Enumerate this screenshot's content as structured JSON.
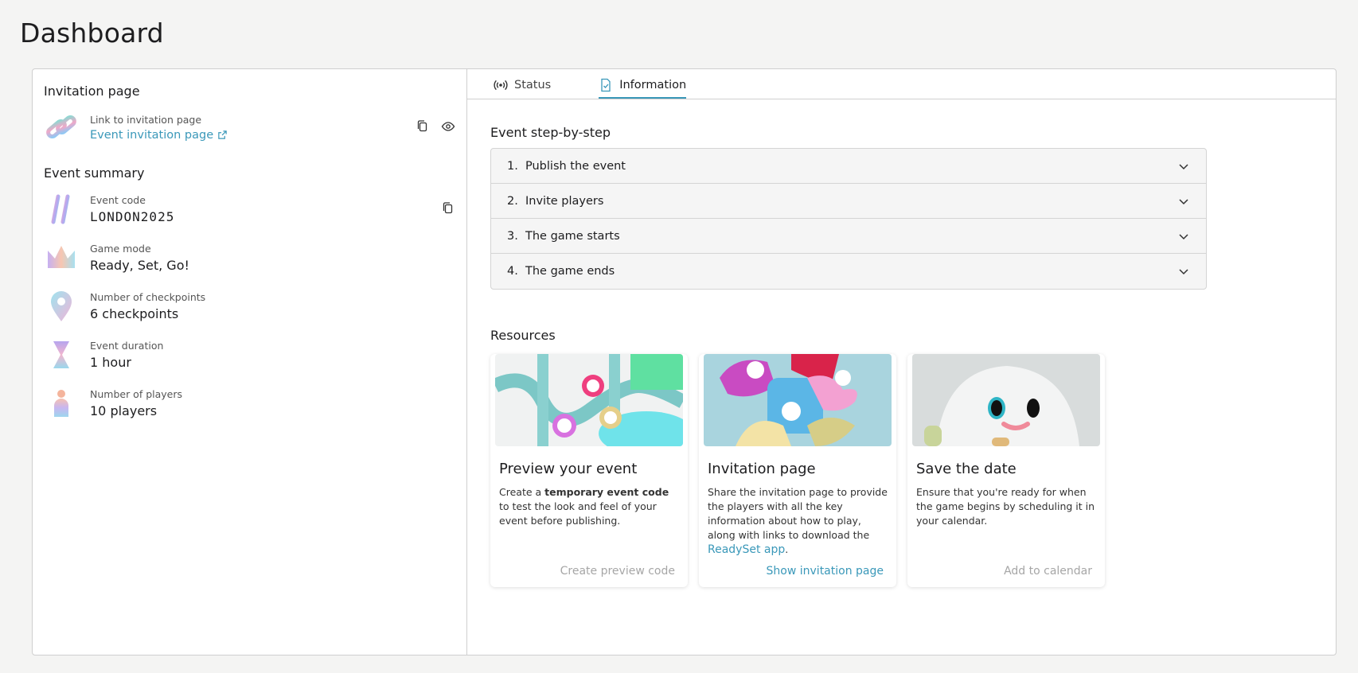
{
  "page": {
    "title": "Dashboard"
  },
  "invitation": {
    "section_title": "Invitation page",
    "link_label": "Link to invitation page",
    "link_text": "Event invitation page"
  },
  "summary": {
    "section_title": "Event summary",
    "items": [
      {
        "label": "Event code",
        "value": "LONDON2025",
        "icon": "hashtag-icon"
      },
      {
        "label": "Game mode",
        "value": "Ready, Set, Go!",
        "icon": "crown-icon"
      },
      {
        "label": "Number of checkpoints",
        "value": "6 checkpoints",
        "icon": "map-pin-icon"
      },
      {
        "label": "Event duration",
        "value": "1 hour",
        "icon": "hourglass-icon"
      },
      {
        "label": "Number of players",
        "value": "10 players",
        "icon": "player-icon"
      }
    ]
  },
  "tabs": [
    {
      "label": "Status",
      "icon": "broadcast-icon",
      "active": false
    },
    {
      "label": "Information",
      "icon": "document-check-icon",
      "active": true
    }
  ],
  "steps": {
    "title": "Event step-by-step",
    "items": [
      {
        "num": "1.",
        "label": "Publish the event"
      },
      {
        "num": "2.",
        "label": "Invite players"
      },
      {
        "num": "3.",
        "label": "The game starts"
      },
      {
        "num": "4.",
        "label": "The game ends"
      }
    ]
  },
  "resources": {
    "title": "Resources",
    "cards": [
      {
        "title": "Preview your event",
        "desc_pre": "Create a ",
        "desc_bold": "temporary event code",
        "desc_post": " to test the look and feel of your event before publishing.",
        "cta": "Create preview code"
      },
      {
        "title": "Invitation page",
        "desc_pre": "Share the invitation page to provide the players with all the key information about how to play, along with links to download the ",
        "desc_link": "ReadySet app",
        "desc_post": ".",
        "cta": "Show invitation page"
      },
      {
        "title": "Save the date",
        "desc_pre": "Ensure that you're ready for when the game begins by scheduling it in your calendar.",
        "cta": "Add to calendar"
      }
    ]
  },
  "colors": {
    "accent": "#3a98b9",
    "disabled": "#a6a6a6",
    "border": "#cfcfcf"
  }
}
